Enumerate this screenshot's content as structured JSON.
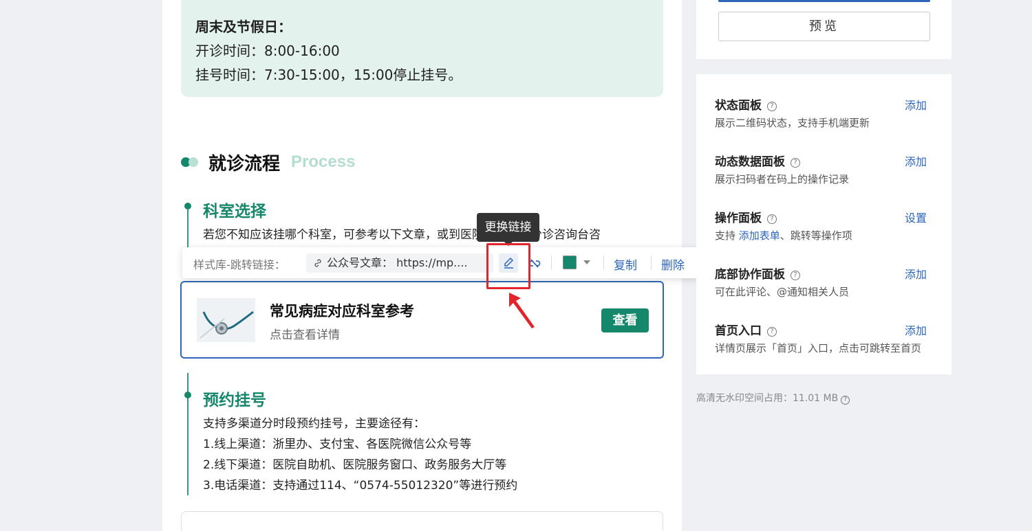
{
  "hours": {
    "title": "周末及节假日：",
    "line1": "开诊时间：8:00-16:00",
    "line2": "挂号时间：7:30-15:00，15:00停止挂号。"
  },
  "section": {
    "title": "就诊流程",
    "subtitle_en": "Process"
  },
  "steps": [
    {
      "title": "科室选择",
      "lines": [
        "若您不知应该挂哪个科室，可参考以下文章，或到医院一楼预检分诊咨询台咨"
      ]
    },
    {
      "title": "预约挂号",
      "lines": [
        "支持多渠道分时段预约挂号，主要途径有：",
        "1.线上渠道：浙里办、支付宝、各医院微信公众号等",
        "2.线下渠道：医院自助机、医院服务窗口、政务服务大厅等",
        "3.电话渠道：支持通过114、“0574-55012320”等进行预约"
      ]
    }
  ],
  "link_card": {
    "title": "常见病症对应科室参考",
    "subtitle": "点击查看详情",
    "button": "查看"
  },
  "toolbar": {
    "label": "样式库-跳转链接：",
    "chip_text": "公众号文章：  https://mp....",
    "color": "#15876a",
    "copy": "复制",
    "delete": "删除",
    "tooltip": "更换链接"
  },
  "right_panel": {
    "preview_button": "预览",
    "items": [
      {
        "title": "状态面板",
        "action": "添加",
        "desc": "展示二维码状态，支持手机端更新"
      },
      {
        "title": "动态数据面板",
        "action": "添加",
        "desc": "展示扫码者在码上的操作记录"
      },
      {
        "title": "操作面板",
        "action": "设置",
        "desc_prefix": "支持 ",
        "desc_link": "添加表单",
        "desc_suffix": "、跳转等操作项"
      },
      {
        "title": "底部协作面板",
        "action": "添加",
        "desc": "可在此评论、@通知相关人员"
      },
      {
        "title": "首页入口",
        "action": "添加",
        "desc": "详情页展示「首页」入口，点击可跳转至首页"
      }
    ],
    "storage": "高清无水印空间占用：11.01 MB"
  },
  "colors": {
    "accent_green": "#17876b",
    "link_blue": "#2f65b8",
    "highlight_red": "#e0262c"
  }
}
